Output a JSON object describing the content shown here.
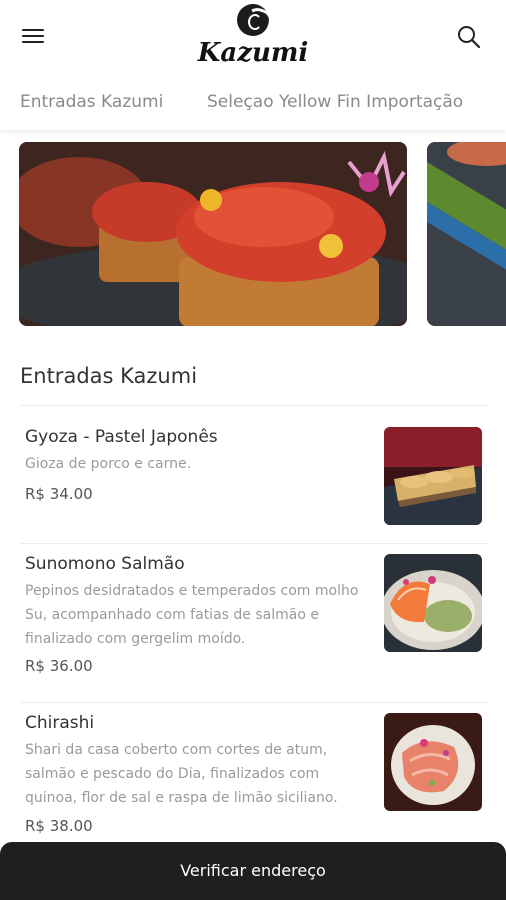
{
  "header": {
    "brand": "Kazumi",
    "menu_icon": "hamburger-menu-icon",
    "search_icon": "search-icon"
  },
  "tabs": [
    {
      "label": "Entradas Kazumi"
    },
    {
      "label": "Seleçao Yellow Fin Importação"
    }
  ],
  "section": {
    "title": "Entradas Kazumi"
  },
  "items": [
    {
      "name": "Gyoza - Pastel Japonês",
      "description": "Gioza de porco e carne.",
      "price": "R$ 34.00"
    },
    {
      "name": "Sunomono Salmão",
      "description": "Pepinos desidratados e temperados com molho Su, acompanhado com fatias de salmão e finalizado com gergelim moído.",
      "price": "R$ 36.00"
    },
    {
      "name": "Chirashi",
      "description": "Shari da casa coberto com cortes de atum, salmão e pescado do Dia, finalizados com quinoa, flor de sal e raspa de limão siciliano.",
      "price": "R$ 38.00"
    }
  ],
  "bottom_button": {
    "label": "Verificar endereço"
  },
  "colors": {
    "bottom_bar": "#1f1f1f",
    "muted_text": "#9a9a9a",
    "tab_text": "#8a8a8a"
  }
}
